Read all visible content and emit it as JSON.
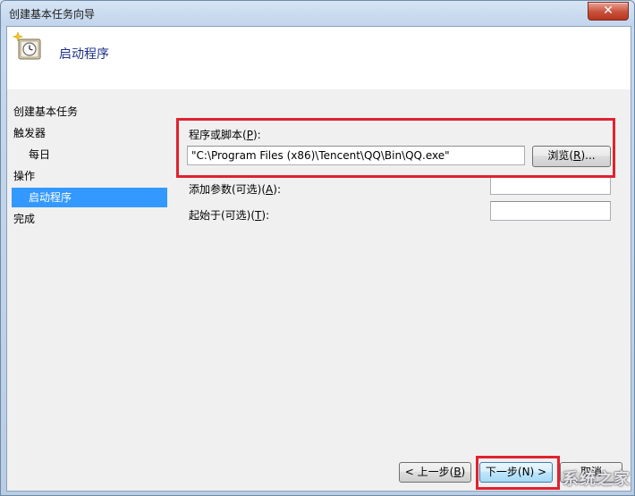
{
  "window": {
    "title": "创建基本任务向导",
    "close_symbol": "✕"
  },
  "header": {
    "title": "启动程序",
    "icon": "clock-sparkle-icon"
  },
  "nav": {
    "items": [
      {
        "label": "创建基本任务"
      },
      {
        "label": "触发器"
      },
      {
        "label": "每日"
      },
      {
        "label": "操作"
      },
      {
        "label": "启动程序"
      },
      {
        "label": "完成"
      }
    ]
  },
  "form": {
    "program_label_text": "程序或脚本(",
    "program_label_key": "P",
    "program_label_tail": "):",
    "program_value": "\"C:\\Program Files (x86)\\Tencent\\QQ\\Bin\\QQ.exe\"",
    "browse_text": "浏览(",
    "browse_key": "R",
    "browse_tail": ")...",
    "args_label_text": "添加参数(可选)(",
    "args_label_key": "A",
    "args_label_tail": "):",
    "args_value": "",
    "startin_label_text": "起始于(可选)(",
    "startin_label_key": "T",
    "startin_label_tail": "):",
    "startin_value": ""
  },
  "footer": {
    "back_text": "< 上一步(",
    "back_key": "B",
    "back_tail": ")",
    "next_label": "下一步(N) >",
    "cancel_label": "取消"
  },
  "watermark": "系统之家",
  "colors": {
    "highlight": "#e02230",
    "selection": "#3399ff",
    "header_title": "#1e3287"
  }
}
